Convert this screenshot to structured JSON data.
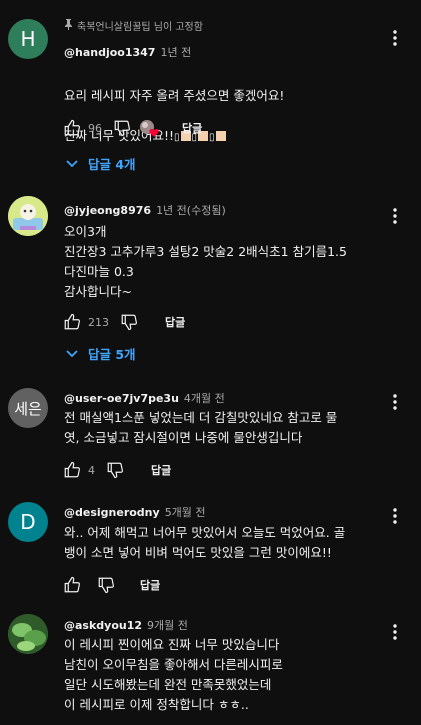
{
  "comments": [
    {
      "pinned_text": "축복언니살림꿀팁 님이 고정함",
      "avatar_letter": "H",
      "author": "@handjoo1347",
      "time": "1년 전",
      "text_line1": "요리 레시피 자주 올려 주셨으면 좋겠어요!",
      "text_line2": "진짜 너무 맛있어요!!",
      "likes": "96",
      "reply_label": "답글",
      "replies_label": "답글 4개"
    },
    {
      "author": "@jyjeong8976",
      "time": "1년 전(수정됨)",
      "text": "오이3개\n진간장3 고추가루3 설탕2 맛술2  2배식초1 참기름1.5\n다진마늘 0.3\n감사합니다~",
      "likes": "213",
      "reply_label": "답글",
      "replies_label": "답글 5개"
    },
    {
      "avatar_text": "세은",
      "author": "@user-oe7jv7pe3u",
      "time": "4개월 전",
      "text": "전 매실액1스푼 넣었는데 더 감칠맛있네요 참고로 물\n엿, 소금넣고 잠시절이면 나중에 물안생깁니다",
      "likes": "4",
      "reply_label": "답글"
    },
    {
      "avatar_letter": "D",
      "author": "@designerodny",
      "time": "5개월 전",
      "text": "와.. 어제 해먹고 너어무 맛있어서 오늘도 먹었어요. 골\n뱅이 소면 넣어 비벼 먹어도 맛있을 그런 맛이에요!!",
      "reply_label": "답글"
    },
    {
      "author": "@askdyou12",
      "time": "9개월 전",
      "text": "이 레시피 찐이에요 진짜 너무 맛있습니다\n남친이 오이무침을 좋아해서 다른레시피로\n일단 시도해봤는데 완전 만족못했었는데\n이 레시피로 이제 정착합니다 ㅎㅎ.."
    }
  ],
  "colors": {
    "background": "#0f0f0f",
    "link": "#3ea6ff",
    "secondary_text": "#aaaaaa",
    "heart": "#ff0033"
  },
  "icons": [
    "pin-icon",
    "like-icon",
    "dislike-icon",
    "creator-heart-icon",
    "more-vert-icon",
    "chevron-down-icon"
  ]
}
